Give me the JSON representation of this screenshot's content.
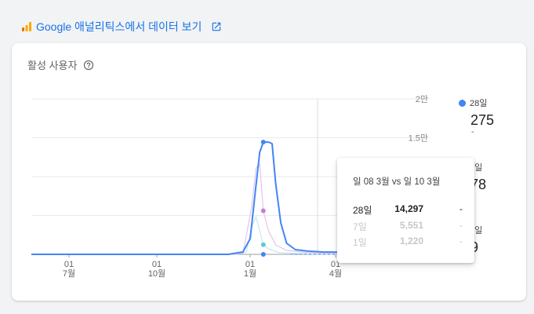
{
  "header": {
    "link_text": "Google 애널리틱스에서 데이터 보기"
  },
  "card": {
    "title": "활성 사용자"
  },
  "colors": {
    "series_28": "#4285f4",
    "series_7": "#e8c2ea",
    "series_1": "#c5e9ee",
    "ga_orange": "#f9ab00",
    "ga_orange_dark": "#e37400",
    "link": "#1a73e8"
  },
  "legend": [
    {
      "label": "28일",
      "value": "275",
      "change": "-"
    },
    {
      "label": "7일",
      "value": "78",
      "change": ""
    },
    {
      "label": "1일",
      "value": "9",
      "change": ""
    }
  ],
  "tooltip": {
    "title": "일 08 3월 vs 일 10 3월",
    "rows": [
      {
        "label": "28일",
        "value": "14,297",
        "change": "-"
      },
      {
        "label": "7일",
        "value": "5,551",
        "change": "-"
      },
      {
        "label": "1일",
        "value": "1,220",
        "change": "-"
      }
    ]
  },
  "chart_data": {
    "type": "line",
    "y_ticks": [
      "2만",
      "1.5만",
      "",
      "",
      "0"
    ],
    "ylim": [
      0,
      20000
    ],
    "x_ticks": [
      {
        "day": "01",
        "month": "7월"
      },
      {
        "day": "01",
        "month": "10월"
      },
      {
        "day": "01",
        "month": "1월"
      },
      {
        "day": "01",
        "month": "4월"
      }
    ],
    "series": [
      {
        "name": "28일",
        "points": [
          [
            0,
            0
          ],
          [
            40,
            0
          ],
          [
            80,
            0
          ],
          [
            120,
            0
          ],
          [
            160,
            0
          ],
          [
            200,
            0
          ],
          [
            240,
            0
          ],
          [
            270,
            0
          ],
          [
            283,
            200
          ],
          [
            290,
            300
          ],
          [
            300,
            2000
          ],
          [
            307,
            8000
          ],
          [
            313,
            13000
          ],
          [
            318,
            14297
          ],
          [
            325,
            14297
          ],
          [
            330,
            14100
          ],
          [
            335,
            9000
          ],
          [
            342,
            4000
          ],
          [
            350,
            1400
          ],
          [
            362,
            600
          ],
          [
            380,
            400
          ],
          [
            400,
            300
          ],
          [
            430,
            275
          ]
        ]
      },
      {
        "name": "7일",
        "points": [
          [
            0,
            0
          ],
          [
            270,
            0
          ],
          [
            290,
            100
          ],
          [
            302,
            6000
          ],
          [
            308,
            11000
          ],
          [
            313,
            11500
          ],
          [
            318,
            5551
          ],
          [
            325,
            3000
          ],
          [
            335,
            1200
          ],
          [
            350,
            500
          ],
          [
            380,
            200
          ],
          [
            430,
            78
          ]
        ]
      },
      {
        "name": "1일",
        "points": [
          [
            0,
            0
          ],
          [
            280,
            0
          ],
          [
            295,
            300
          ],
          [
            302,
            3500
          ],
          [
            308,
            4800
          ],
          [
            313,
            3000
          ],
          [
            318,
            1220
          ],
          [
            325,
            700
          ],
          [
            340,
            200
          ],
          [
            380,
            50
          ],
          [
            430,
            9
          ]
        ]
      }
    ]
  }
}
